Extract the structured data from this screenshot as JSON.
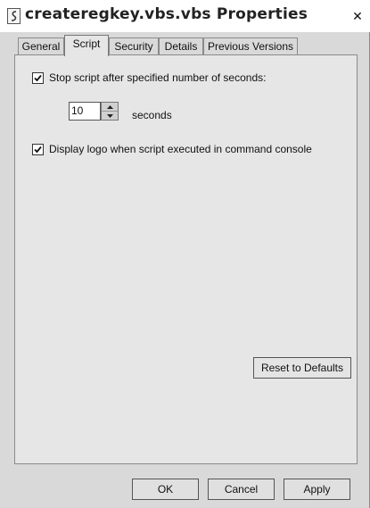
{
  "window": {
    "title": "createregkey.vbs.vbs Properties",
    "close_glyph": "✕"
  },
  "tabs": [
    {
      "label": "General"
    },
    {
      "label": "Script",
      "active": true
    },
    {
      "label": "Security"
    },
    {
      "label": "Details"
    },
    {
      "label": "Previous Versions"
    }
  ],
  "script": {
    "stop_script_label": "Stop script after specified number of seconds:",
    "stop_script_checked": true,
    "seconds_value": "10",
    "seconds_label": "seconds",
    "display_logo_label": "Display logo when script executed in command console",
    "display_logo_checked": true,
    "reset_button": "Reset to Defaults"
  },
  "buttons": {
    "ok": "OK",
    "cancel": "Cancel",
    "apply": "Apply"
  },
  "icons": {
    "title": "script-file-icon",
    "check": "check-icon",
    "spin_up": "chevron-up-icon",
    "spin_down": "chevron-down-icon"
  }
}
